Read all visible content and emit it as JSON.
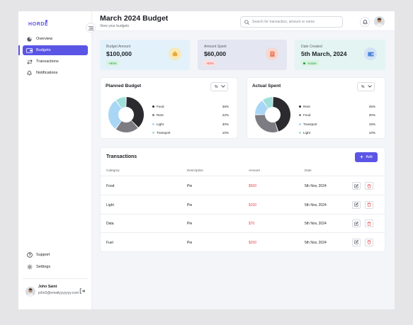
{
  "brand": {
    "name": "HORDE"
  },
  "sidebar": {
    "items": [
      {
        "label": "Overview",
        "icon": "overview-icon"
      },
      {
        "label": "Budgets",
        "icon": "wallet-icon",
        "active": true
      },
      {
        "label": "Transactions",
        "icon": "transfer-icon"
      },
      {
        "label": "Notifications",
        "icon": "bell-icon"
      }
    ],
    "bottom_items": [
      {
        "label": "Support",
        "icon": "help-icon"
      },
      {
        "label": "Settings",
        "icon": "gear-icon"
      }
    ],
    "user": {
      "name": "John Saint",
      "email": "john5@emailyyyyyyy.com"
    }
  },
  "header": {
    "title": "March 2024 Budget",
    "subtitle": "View your budgets",
    "search_placeholder": "Search for transaction, amount or name"
  },
  "stats": [
    {
      "label": "Budget Amount",
      "value": "$100,000",
      "badge": "+90%",
      "bg": "#e3f1fb",
      "badge_bg": "#d8f3df",
      "badge_color": "#1f9a4b",
      "icon_bg": "#f7e9b8",
      "icon_color": "#e9a83a"
    },
    {
      "label": "Amount Spent",
      "value": "$60,000",
      "badge": "-60%",
      "bg": "#e4e7f1",
      "badge_bg": "#fbe0e0",
      "badge_color": "#e5484d",
      "icon_bg": "#f6d8cf",
      "icon_color": "#ea7a5f"
    },
    {
      "label": "Date Created",
      "value": "5th March, 2024",
      "badge": "Active",
      "bg": "#e3f4f3",
      "badge_bg": "#d8f3df",
      "badge_color": "#1f9a4b",
      "icon_bg": "#d3e2f6",
      "icon_color": "#4f86d8"
    }
  ],
  "planned": {
    "title": "Planned Budget",
    "dropdown": "%",
    "chart_data": {
      "type": "pie",
      "categories": [
        "Food",
        "Rent",
        "Light",
        "Transport"
      ],
      "values": [
        38,
        22,
        30,
        10
      ],
      "colors": [
        "#2b2b2f",
        "#7c7c82",
        "#a9d6f5",
        "#9fe0dc"
      ]
    }
  },
  "actual": {
    "title": "Actual Spent",
    "dropdown": "%",
    "chart_data": {
      "type": "pie",
      "categories": [
        "Rent",
        "Food",
        "Transport",
        "Light"
      ],
      "values": [
        45,
        30,
        15,
        10
      ],
      "colors": [
        "#2b2b2f",
        "#7c7c82",
        "#a9d6f5",
        "#9fe0dc"
      ]
    }
  },
  "transactions": {
    "title": "Transactions",
    "add_label": "Add",
    "columns": [
      "Category",
      "Description",
      "Amount",
      "Date"
    ],
    "rows": [
      {
        "category": "Food",
        "description": "Pie",
        "amount": "$500",
        "date": "5th Nov, 2024"
      },
      {
        "category": "Light",
        "description": "Pie",
        "amount": "$100",
        "date": "5th Nov, 2024"
      },
      {
        "category": "Data",
        "description": "Pie",
        "amount": "$70",
        "date": "5th Nov, 2024"
      },
      {
        "category": "Fuel",
        "description": "Pie",
        "amount": "$200",
        "date": "5th Nov, 2024"
      }
    ]
  }
}
